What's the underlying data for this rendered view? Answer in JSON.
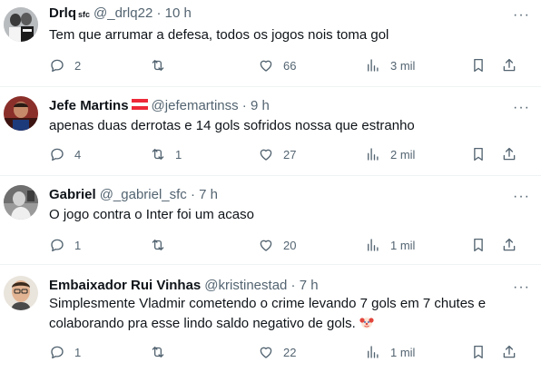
{
  "tweets": [
    {
      "name": "Drlq",
      "badge": "sfc",
      "meta": "@_drlq22 · 10 h",
      "text": "Tem que arrumar a defesa, todos os jogos nois toma gol",
      "replies": "2",
      "retweets": "",
      "likes": "66",
      "views": "3 mil"
    },
    {
      "name": "Jefe Martins",
      "flag": "austria-flag",
      "meta": "@jefemartinss · 9 h",
      "text": "apenas duas derrotas e 14 gols sofridos nossa que estranho",
      "replies": "4",
      "retweets": "1",
      "likes": "27",
      "views": "2 mil"
    },
    {
      "name": "Gabriel",
      "meta": "@_gabriel_sfc · 7 h",
      "text": "O jogo contra o Inter foi um acaso",
      "replies": "1",
      "retweets": "",
      "likes": "20",
      "views": "1 mil"
    },
    {
      "name": "Embaixador Rui Vinhas",
      "meta": "@kristinestad · 7 h",
      "text": "Simplesmente Vladmir cometendo o crime levando 7 gols em 7 chutes e colaborando pra esse lindo saldo negativo de gols.",
      "emoji": "clown-face-emoji",
      "replies": "1",
      "retweets": "",
      "likes": "22",
      "views": "1 mil"
    }
  ],
  "icons": {
    "reply": "reply-icon",
    "retweet": "retweet-icon",
    "like": "like-icon",
    "views": "views-icon",
    "bookmark": "bookmark-icon",
    "share": "share-icon",
    "more": "more-icon"
  },
  "colors": {
    "text": "#0f1419",
    "secondary": "#536471",
    "divider": "#eff3f4"
  }
}
